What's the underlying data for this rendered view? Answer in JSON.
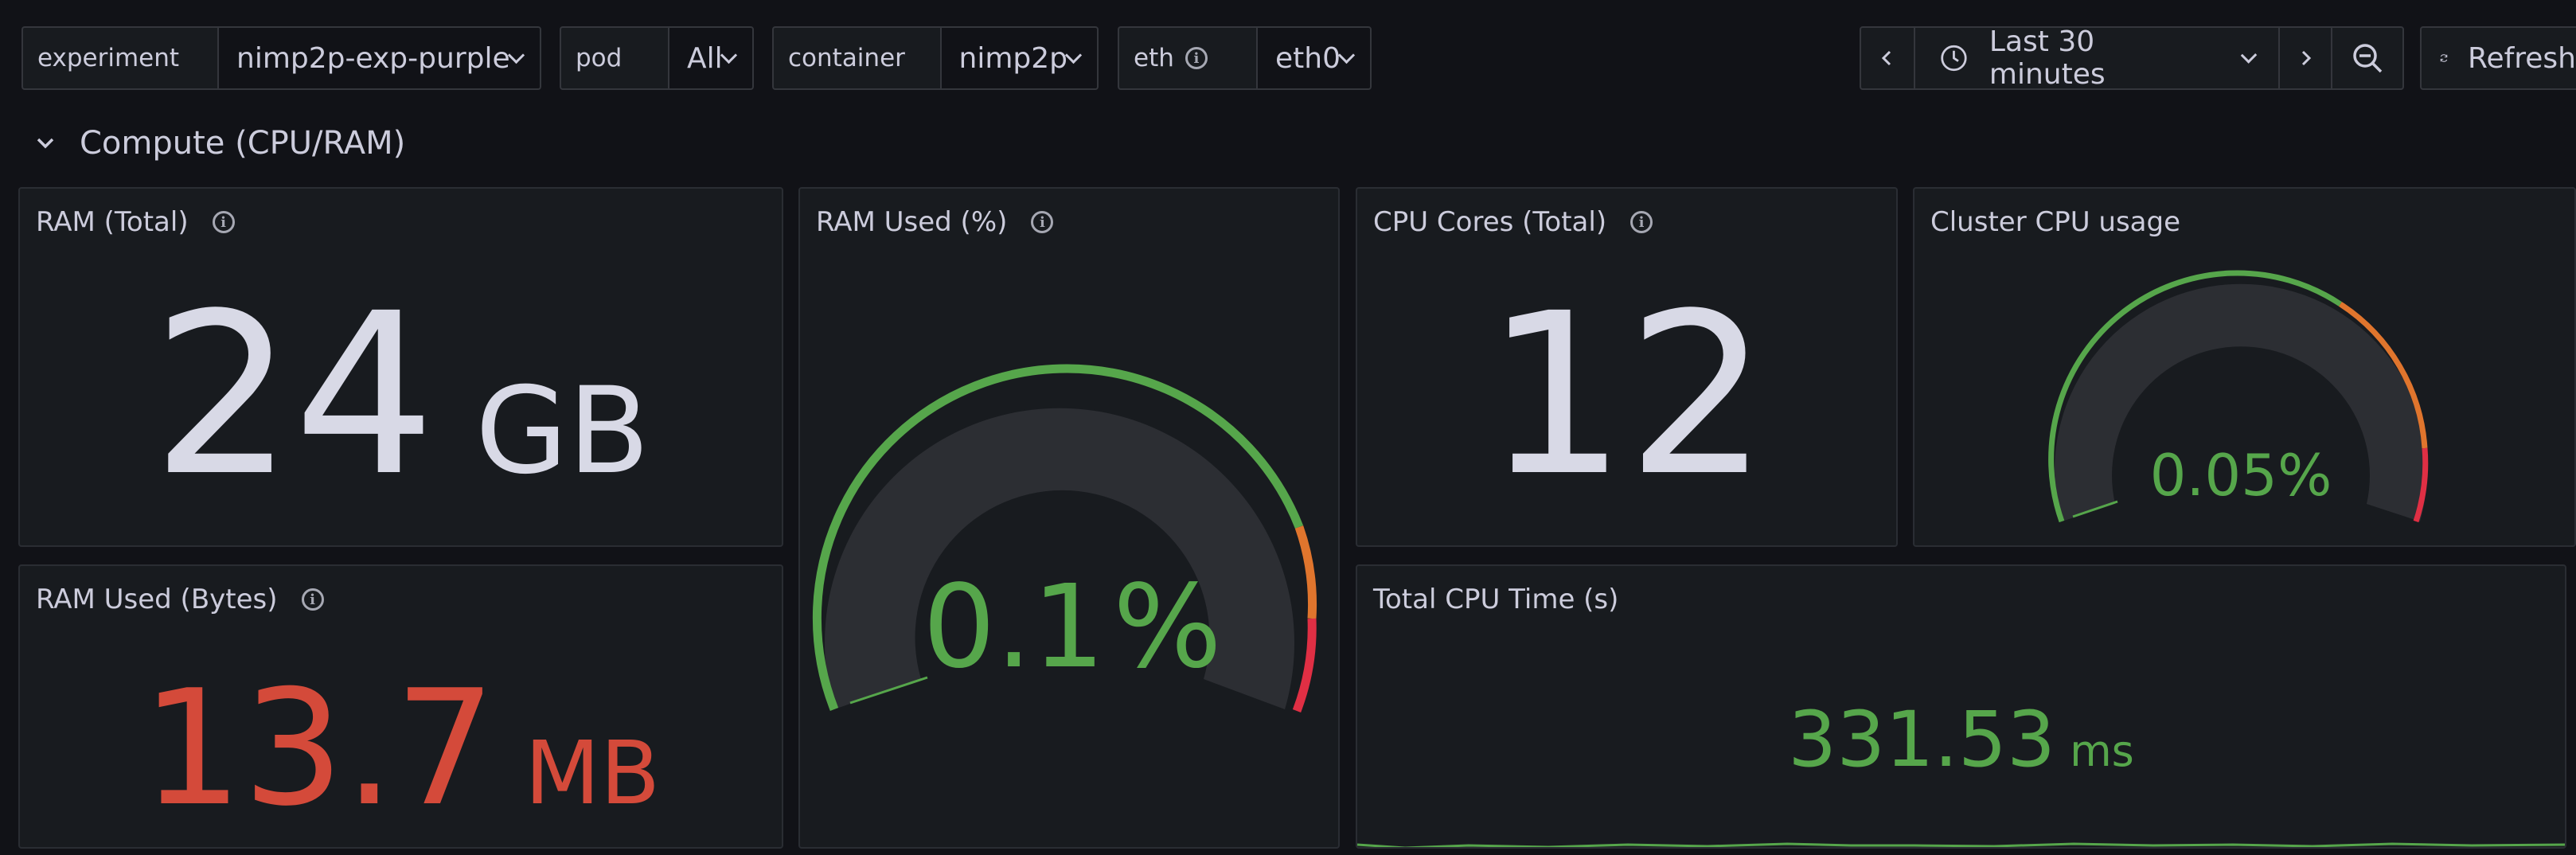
{
  "variables": [
    {
      "label": "experiment",
      "value": "nimp2p-exp-purple"
    },
    {
      "label": "pod",
      "value": "All"
    },
    {
      "label": "container",
      "value": "nimp2p"
    },
    {
      "label": "eth",
      "value": "eth0"
    }
  ],
  "time": {
    "range": "Last 30 minutes",
    "refresh": "Refresh"
  },
  "row": {
    "title": "Compute (CPU/RAM)"
  },
  "panels": {
    "ram_total": {
      "title": "RAM (Total)",
      "value": "24",
      "unit": "GB"
    },
    "ram_used_pct": {
      "title": "RAM Used (%)",
      "value": "0.1",
      "unit": "%",
      "level": 0.001
    },
    "cpu_cores": {
      "title": "CPU Cores (Total)",
      "value": "12"
    },
    "cluster_cpu": {
      "title": "Cluster CPU usage",
      "value": "0.05%",
      "level": 0.0005
    },
    "ram_used_bytes": {
      "title": "RAM Used (Bytes)",
      "value": "13.7",
      "unit": "MB"
    },
    "cpu_time": {
      "title": "Total CPU Time (s)",
      "value": "331.53",
      "unit": "ms"
    }
  },
  "colors": {
    "green": "#56a64b",
    "orange": "#e0752d",
    "red": "#e02f44",
    "ram_red": "#d44a3a"
  }
}
